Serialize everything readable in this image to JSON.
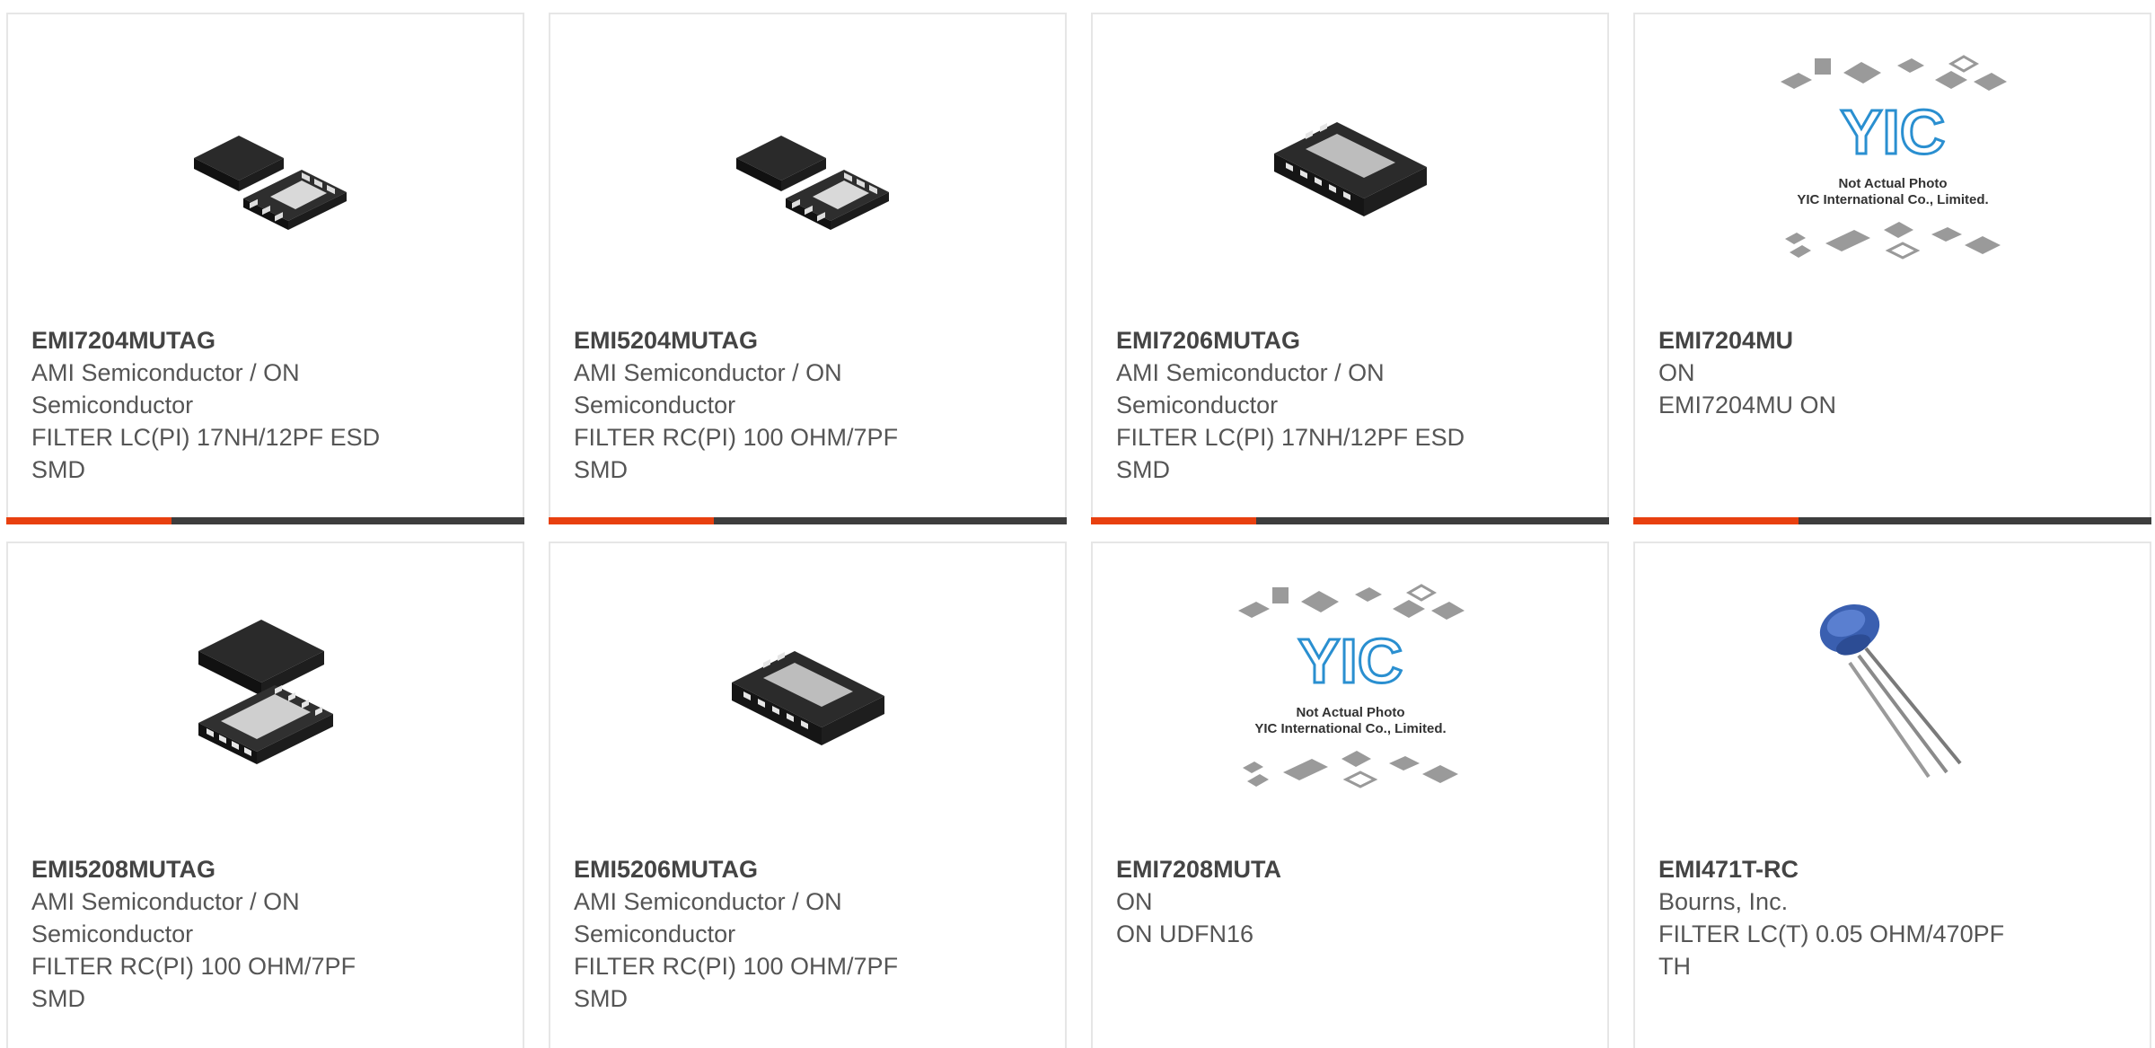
{
  "products": [
    {
      "part": "EMI7204MUTAG",
      "manufacturer": "AMI Semiconductor / ON Semiconductor",
      "description": "FILTER LC(PI) 17NH/12PF ESD SMD",
      "image": "chip-pair-icon"
    },
    {
      "part": "EMI5204MUTAG",
      "manufacturer": "AMI Semiconductor / ON Semiconductor",
      "description": "FILTER RC(PI) 100 OHM/7PF SMD",
      "image": "chip-pair-icon"
    },
    {
      "part": "EMI7206MUTAG",
      "manufacturer": "AMI Semiconductor / ON Semiconductor",
      "description": "FILTER LC(PI) 17NH/12PF ESD SMD",
      "image": "chip-single-icon"
    },
    {
      "part": "EMI7204MU",
      "manufacturer": "ON",
      "description": "EMI7204MU ON",
      "image": "not-actual-photo-icon"
    },
    {
      "part": "EMI5208MUTAG",
      "manufacturer": "AMI Semiconductor / ON Semiconductor",
      "description": "FILTER RC(PI) 100 OHM/7PF SMD",
      "image": "chip-stack-icon"
    },
    {
      "part": "EMI5206MUTAG",
      "manufacturer": "AMI Semiconductor / ON Semiconductor",
      "description": "FILTER RC(PI) 100 OHM/7PF SMD",
      "image": "chip-single-icon"
    },
    {
      "part": "EMI7208MUTA",
      "manufacturer": "ON",
      "description": "ON UDFN16",
      "image": "not-actual-photo-icon"
    },
    {
      "part": "EMI471T-RC",
      "manufacturer": "Bourns, Inc.",
      "description": "FILTER LC(T) 0.05 OHM/470PF TH",
      "image": "radial-capacitor-icon"
    }
  ],
  "placeholder": {
    "line1": "Not Actual Photo",
    "line2": "YIC International Co., Limited.",
    "logo": "YIC"
  },
  "colors": {
    "accent": "#e8400f",
    "bar": "#3d3d3d",
    "border": "#e6e6e6",
    "logo": "#2a8fd0"
  }
}
